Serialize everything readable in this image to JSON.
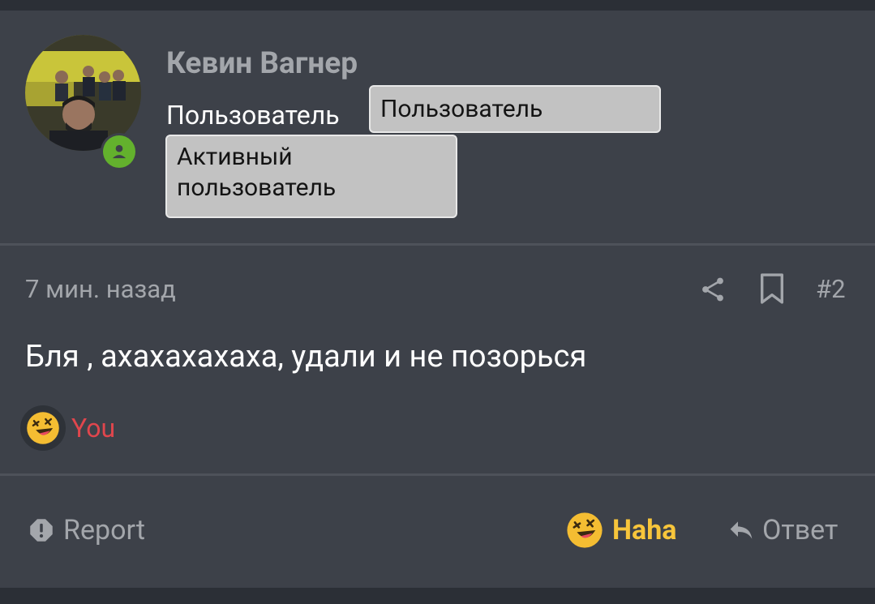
{
  "user": {
    "name": "Кевин Вагнер",
    "title": "Пользователь",
    "banners": [
      "Пользователь",
      "Активный пользователь"
    ],
    "avatar_icon": "user-avatar-photo",
    "status_icon": "online-user-icon",
    "status_color": "#63b12d"
  },
  "post": {
    "time": "7 мин. назад",
    "number": "#2",
    "message": "Бля , ахахахахаха, удали и не позорься",
    "actions_top": [
      "share-icon",
      "bookmark-icon"
    ]
  },
  "reactions": {
    "emoji_icon": "rolling-laughing-emoji-icon",
    "by": "You",
    "by_color": "#e0464d"
  },
  "footer": {
    "report_label": "Report",
    "reaction_label": "Haha",
    "reaction_color": "#f7c53b",
    "reply_label": "Ответ"
  }
}
